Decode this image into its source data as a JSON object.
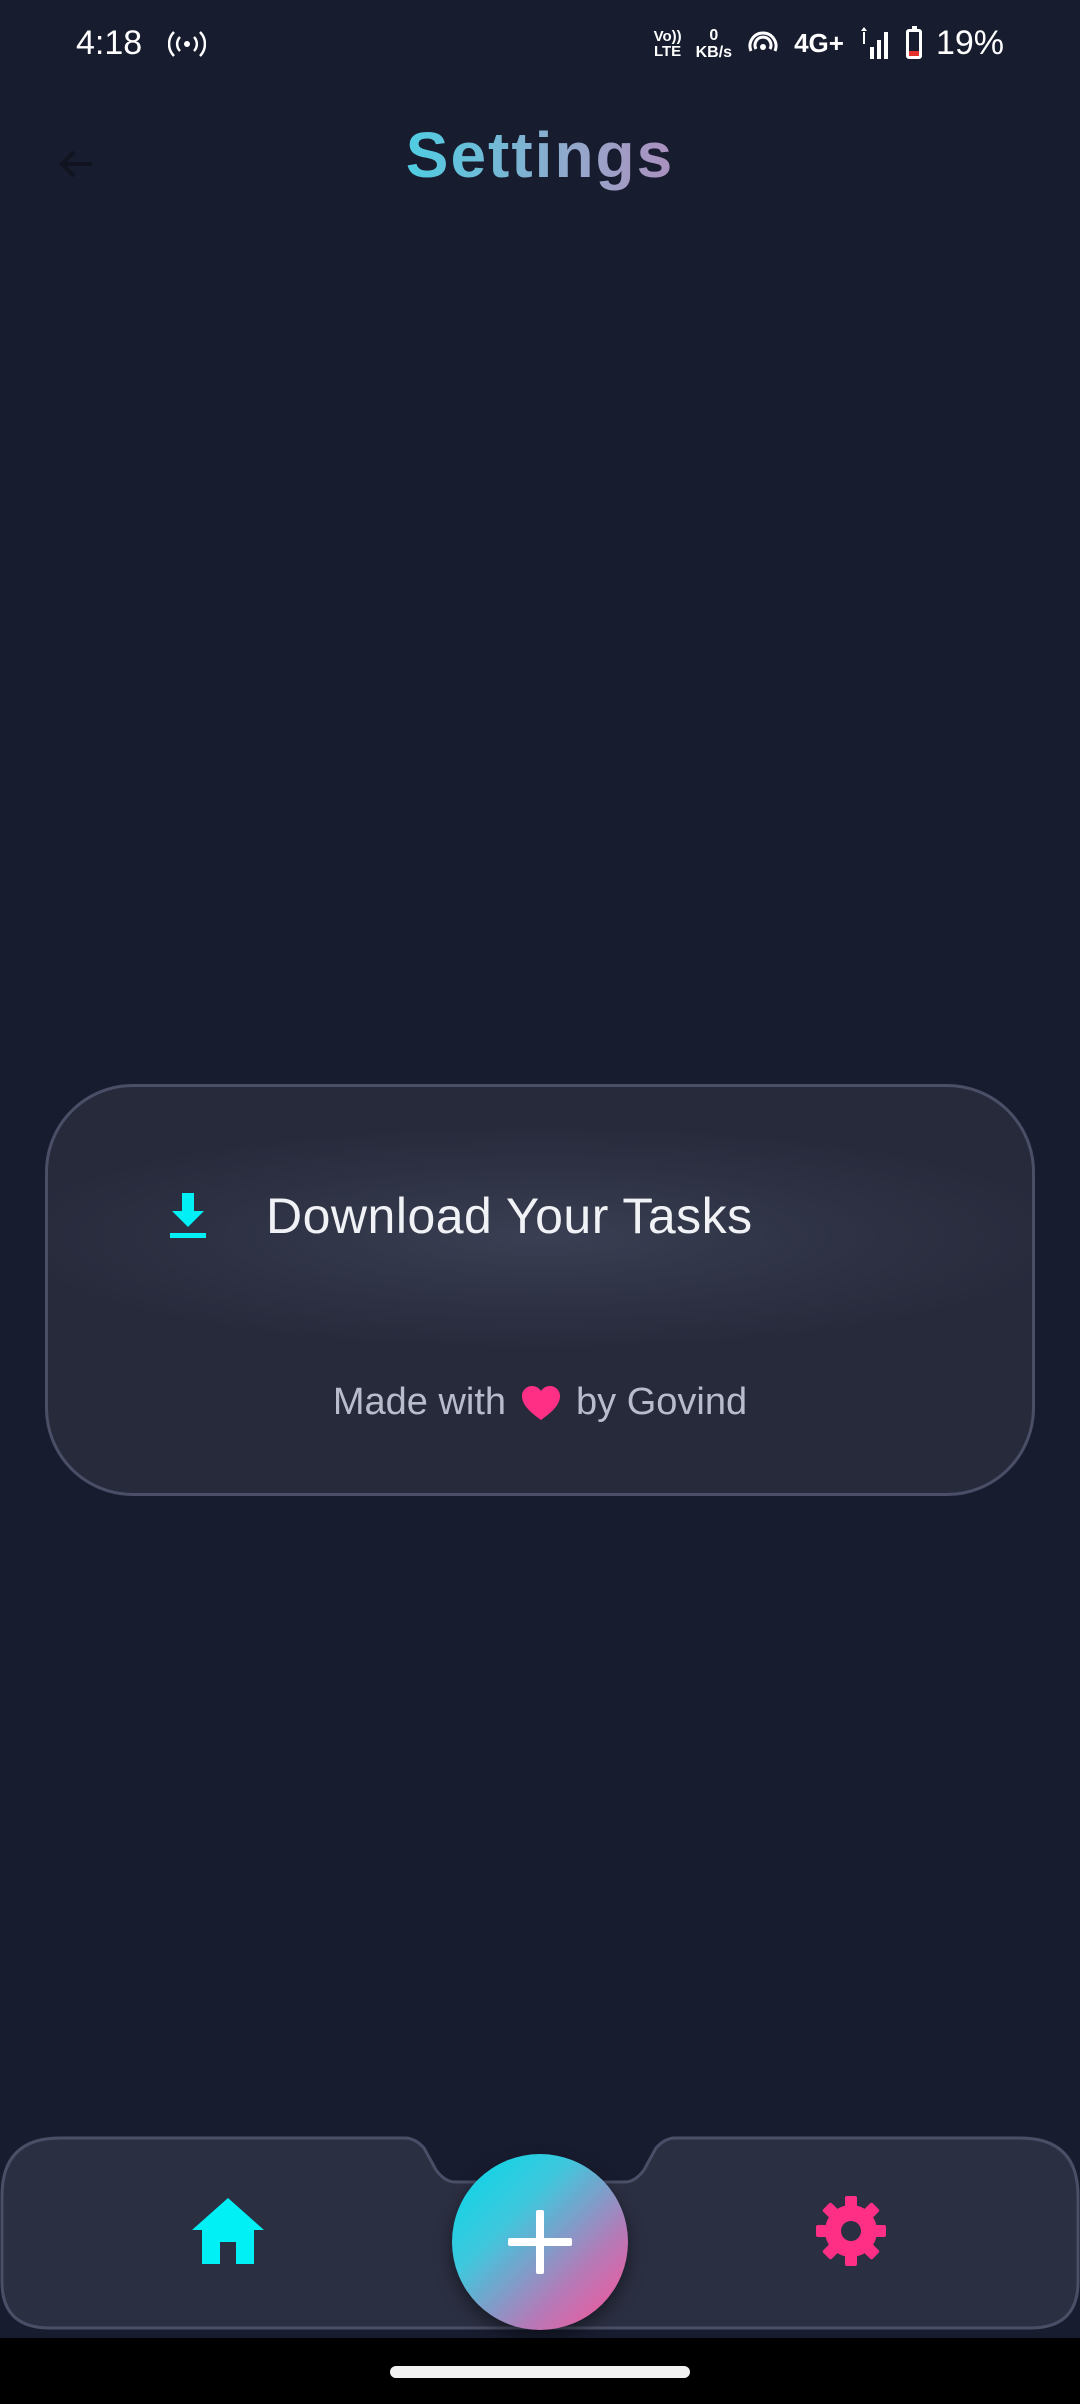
{
  "status_bar": {
    "time": "4:18",
    "volte_top": "Vo))",
    "volte_bottom": "LTE",
    "net_speed_value": "0",
    "net_speed_unit": "KB/s",
    "network": "4G+",
    "battery_percent": "19%",
    "battery_level": 0.19,
    "icons": [
      "hotspot-icon",
      "wifi-calling-icon",
      "signal-icon",
      "battery-icon"
    ]
  },
  "header": {
    "title": "Settings",
    "back_icon": "back-arrow-icon",
    "title_gradient": [
      "#0fe0ee",
      "#ff2d8e"
    ]
  },
  "card": {
    "download_label": "Download Your Tasks",
    "download_icon": "download-icon",
    "credit_prefix": "Made with",
    "credit_suffix": "by Govind",
    "heart_icon": "heart-icon"
  },
  "bottom_nav": {
    "items": [
      {
        "name": "home",
        "icon": "home-icon",
        "color": "#00f0f5"
      },
      {
        "name": "add",
        "icon": "plus-icon",
        "color": "#ffffff"
      },
      {
        "name": "settings",
        "icon": "gear-icon",
        "color": "#ff2f86"
      }
    ]
  },
  "colors": {
    "background": "#181c2f",
    "card": "#2d3143",
    "accent_cyan": "#00f0f5",
    "accent_pink": "#ff2f86"
  }
}
